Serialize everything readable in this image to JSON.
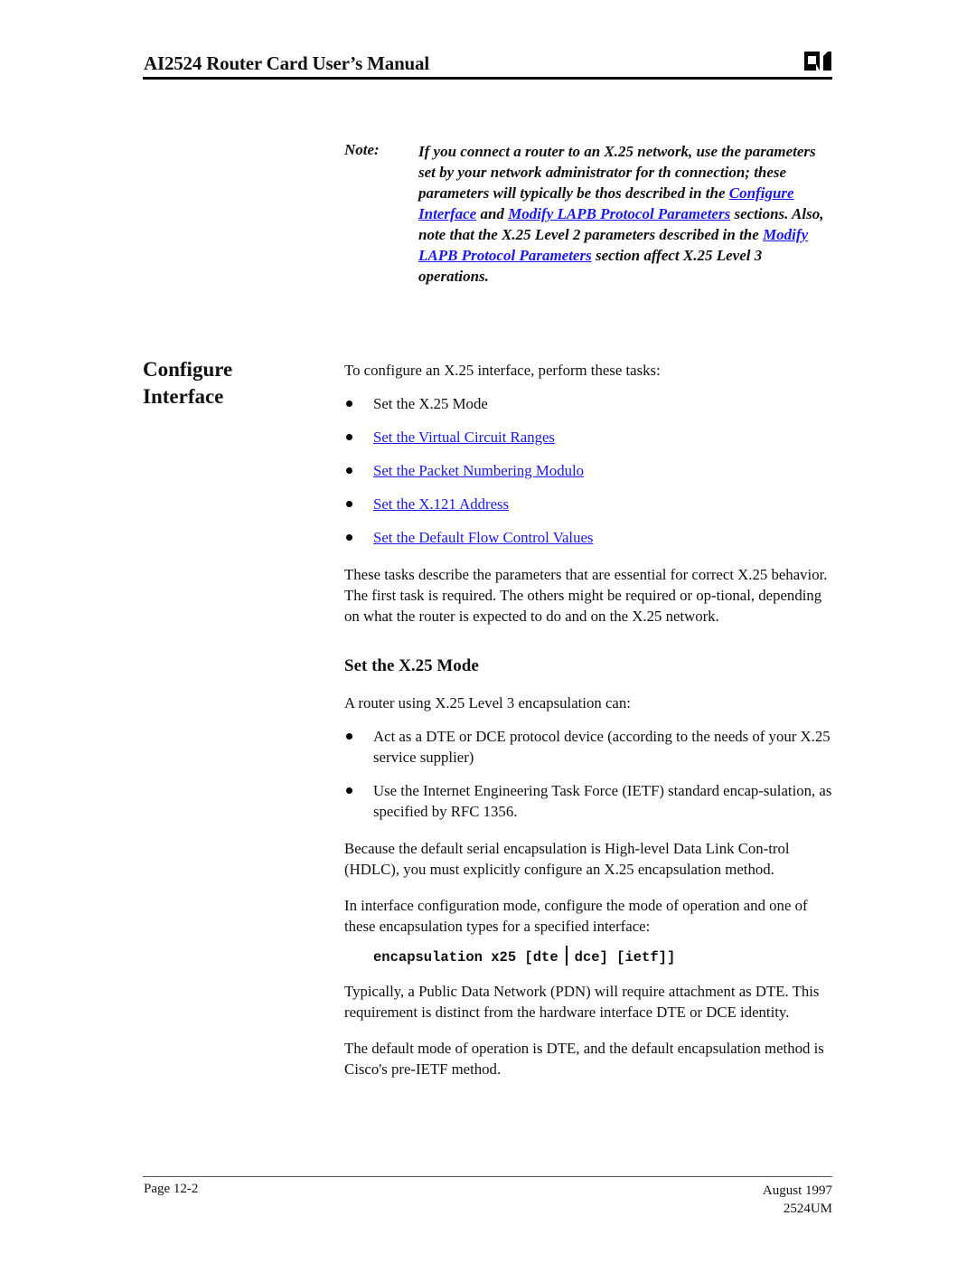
{
  "header": {
    "title": "AI2524 Router Card User’s Manual",
    "logo_icon": "ai-company-logo"
  },
  "note": {
    "label": "Note:",
    "segments": [
      {
        "text": "If you connect a router to an X.25 network, use the parameters set by your network administrator for th connection; these parameters will typically be thos described in the "
      },
      {
        "text": "Configure Interface",
        "link": true
      },
      {
        "text": "  and "
      },
      {
        "text": "Modify LAPB Protocol Parameters",
        "link": true
      },
      {
        "text": " sections. Also, note that the X.25 Level 2 parameters described in the "
      },
      {
        "text": "Modify LAPB Protocol Parameters",
        "link": true
      },
      {
        "text": " section affect X.25 Level 3 operations."
      }
    ]
  },
  "section": {
    "heading_line1": "Configure",
    "heading_line2": "Interface",
    "intro": "To configure an X.25 interface, perform these tasks:",
    "tasks": [
      {
        "label": "Set the X.25 Mode",
        "link": false
      },
      {
        "label": "Set the Virtual Circuit Ranges",
        "link": true
      },
      {
        "label": "Set the Packet Numbering Modulo",
        "link": true
      },
      {
        "label": "Set the X.121 Address",
        "link": true
      },
      {
        "label": "Set the Default Flow Control Values",
        "link": true
      }
    ],
    "tasks_description": "These tasks describe the parameters that are essential for correct X.25 behavior. The first task is required. The others might be required or op-tional, depending on what the router is expected to do and on the X.25 network."
  },
  "subsection": {
    "heading": "Set the X.25 Mode",
    "intro": "A router using X.25 Level 3 encapsulation can:",
    "capabilities": [
      "Act as a DTE or DCE protocol device (according to the needs of your X.25 service supplier)",
      "Use the Internet Engineering Task Force (IETF) standard encap-sulation, as specified by RFC 1356."
    ],
    "para1": "Because the default serial encapsulation is High-level Data Link Con-trol (HDLC), you must explicitly configure an X.25 encapsulation method.",
    "para2": "In interface configuration mode, configure the mode of operation and one of these encapsulation types for a specified interface:",
    "command_part1": "encapsulation x25 [dte",
    "command_part2": "dce] [ietf]]",
    "para3": "Typically, a Public Data Network (PDN) will require attachment as DTE. This requirement is distinct from the hardware interface DTE or DCE identity.",
    "para4": "The default mode of operation is DTE, and the default encapsulation method is Cisco's pre-IETF method."
  },
  "footer": {
    "page": "Page 12-2",
    "date": "August 1997",
    "doc_id": "2524UM"
  },
  "colors": {
    "link": "#1a1aee",
    "text": "#111111"
  }
}
